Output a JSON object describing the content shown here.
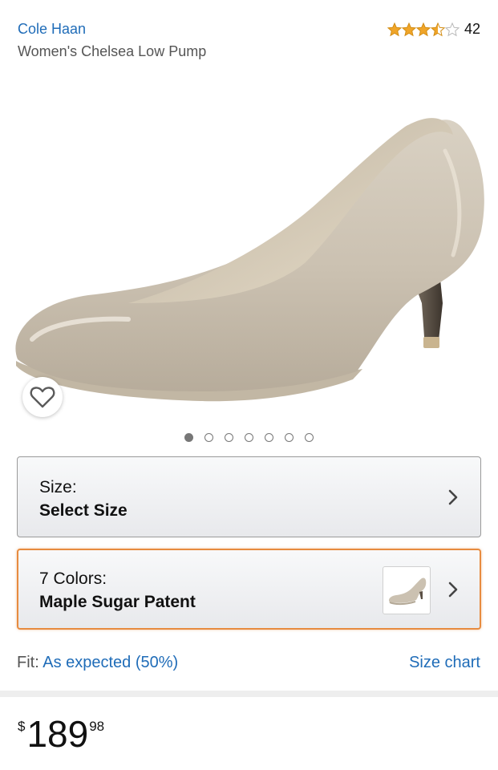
{
  "product": {
    "brand": "Cole Haan",
    "title": "Women's Chelsea Low Pump",
    "rating_stars": 3.5,
    "rating_max": 5,
    "rating_count": "42"
  },
  "gallery": {
    "image_count": 7,
    "active_index": 0,
    "wishlist_icon": "heart-outline-icon"
  },
  "size_selector": {
    "label": "Size:",
    "value": "Select Size"
  },
  "color_selector": {
    "label": "7 Colors:",
    "value": "Maple Sugar Patent"
  },
  "fit": {
    "label": "Fit:",
    "value": "As expected (50%)",
    "size_chart": "Size chart"
  },
  "price": {
    "currency": "$",
    "whole": "189",
    "fraction": "98"
  },
  "colors": {
    "link": "#1f6cb8",
    "star": "#f0a529",
    "focus_border": "#e78b3f"
  }
}
